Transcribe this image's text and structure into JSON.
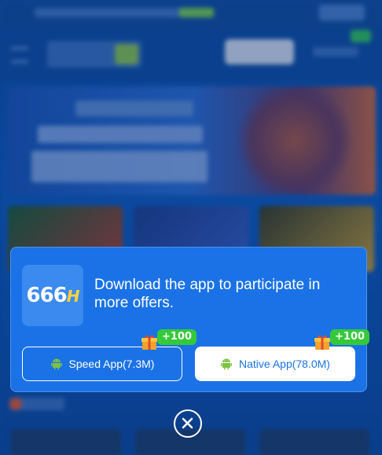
{
  "modal": {
    "logo_text": "666",
    "logo_suffix": "H",
    "message": "Download the app to participate in more offers.",
    "buttons": [
      {
        "label": "Speed App(7.3M)",
        "icon": "android-icon",
        "bonus": "+100"
      },
      {
        "label": "Native App(78.0M)",
        "icon": "android-icon",
        "bonus": "+100"
      }
    ]
  },
  "colors": {
    "modal_bg": "#1a72e6",
    "bonus_green": "#35c93a",
    "android_green": "#7cc242"
  },
  "close_icon": "close-circle-icon"
}
